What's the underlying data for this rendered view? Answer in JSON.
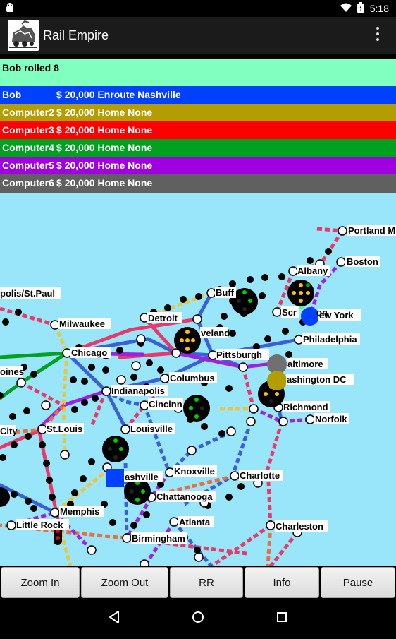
{
  "status_bar": {
    "time": "5:18",
    "icons": [
      "android-debug-icon",
      "wifi-icon",
      "battery-icon"
    ]
  },
  "app_bar": {
    "title": "Rail Empire",
    "icons": [
      "train-logo-icon",
      "overflow-menu-icon"
    ]
  },
  "message": "Bob rolled 8",
  "players": [
    {
      "name": "Bob",
      "info": "$ 20,000 Enroute Nashville",
      "color": "#0040ff"
    },
    {
      "name": "Computer2",
      "info": "$ 20,000 Home None",
      "color": "#b39d00"
    },
    {
      "name": "Computer3",
      "info": "$ 20,000 Home None",
      "color": "#ff0000"
    },
    {
      "name": "Computer4",
      "info": "$ 20,000 Home None",
      "color": "#00a020"
    },
    {
      "name": "Computer5",
      "info": "$ 20,000 Home None",
      "color": "#a000e0"
    },
    {
      "name": "Computer6",
      "info": "$ 20,000 Home None",
      "color": "#606060"
    }
  ],
  "cities": [
    "Portland M",
    "Boston",
    "Albany",
    "polis/St.Paul",
    "Buff",
    "ew York",
    "Milwaukee",
    "Detroit",
    "Scr",
    "on",
    "veland",
    "Philadelphia",
    "Chicago",
    "Pittsburgh",
    "altimore",
    "oines",
    "Indianapolis",
    "Columbus",
    "ashington DC",
    "Cincinn",
    "Richmond",
    "City",
    "St.Louis",
    "Louisville",
    "Norfolk",
    "Knoxville",
    "Charlotte",
    "ashville",
    "Chattanooga",
    "Memphis",
    "Atlanta",
    "Little Rock",
    "Charleston",
    "Birmingham"
  ],
  "map": {
    "water_color": "#99e6fa"
  },
  "buttons": {
    "zoom_in": "Zoom In",
    "zoom_out": "Zoom Out",
    "rr": "RR",
    "info": "Info",
    "pause": "Pause"
  },
  "nav_icons": [
    "back-icon",
    "home-icon",
    "recents-icon"
  ]
}
